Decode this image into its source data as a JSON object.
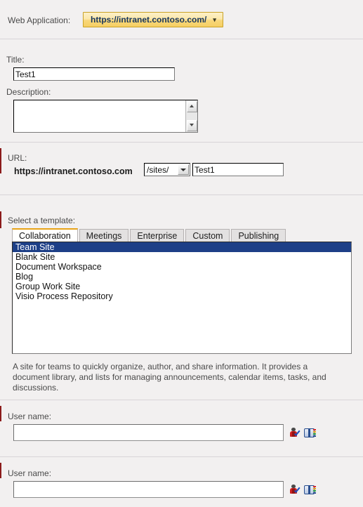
{
  "web_application": {
    "label": "Web Application:",
    "selected": "https://intranet.contoso.com/",
    "caret": "▾"
  },
  "title": {
    "label": "Title:",
    "value": "Test1",
    "placeholder": ""
  },
  "description": {
    "label": "Description:",
    "value": "",
    "placeholder": ""
  },
  "url": {
    "label": "URL:",
    "prefix": "https://intranet.contoso.com",
    "path_selected": "/sites/",
    "name_value": "Test1",
    "name_placeholder": ""
  },
  "template": {
    "label": "Select a template:",
    "tabs": [
      {
        "label": "Collaboration",
        "active": true
      },
      {
        "label": "Meetings",
        "active": false
      },
      {
        "label": "Enterprise",
        "active": false
      },
      {
        "label": "Custom",
        "active": false
      },
      {
        "label": "Publishing",
        "active": false
      }
    ],
    "items": [
      {
        "label": "Team Site",
        "selected": true
      },
      {
        "label": "Blank Site",
        "selected": false
      },
      {
        "label": "Document Workspace",
        "selected": false
      },
      {
        "label": "Blog",
        "selected": false
      },
      {
        "label": "Group Work Site",
        "selected": false
      },
      {
        "label": "Visio Process Repository",
        "selected": false
      }
    ],
    "description": "A site for teams to quickly organize, author, and share information. It provides a document library, and lists for managing announcements, calendar items, tasks, and discussions."
  },
  "user_primary": {
    "label": "User name:",
    "value": "",
    "placeholder": ""
  },
  "user_secondary": {
    "label": "User name:",
    "value": "",
    "placeholder": ""
  },
  "colors": {
    "page_background": "#f2f0f0",
    "accent_gold": "#e8a317",
    "selection_blue": "#1d3f87",
    "required_marker": "#8b1a1a",
    "separator": "#d8d4d8"
  }
}
